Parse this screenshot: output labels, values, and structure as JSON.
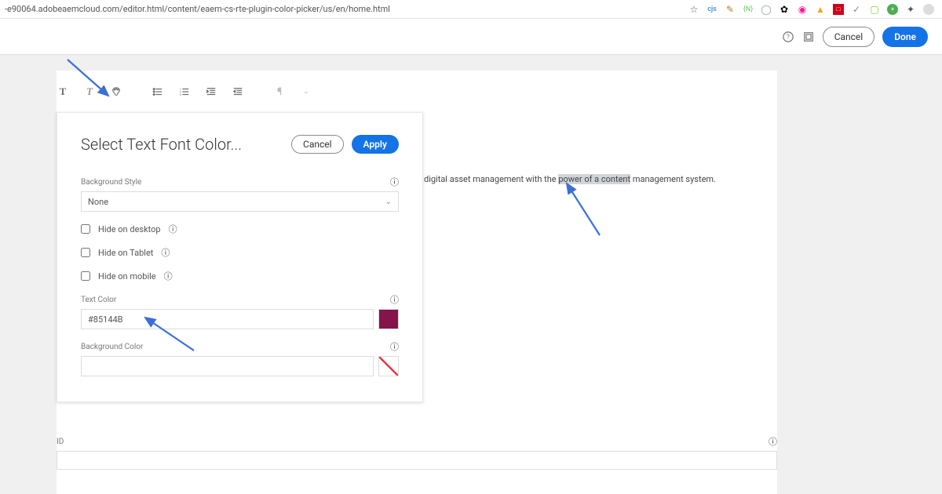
{
  "url": "-e90064.adobeaemcloud.com/editor.html/content/eaem-cs-rte-plugin-color-picker/us/en/home.html",
  "header": {
    "cancel": "Cancel",
    "done": "Done"
  },
  "dialog": {
    "title": "Select Text Font Color...",
    "cancel": "Cancel",
    "apply": "Apply",
    "bg_style_label": "Background Style",
    "bg_style_value": "None",
    "hide_desktop": "Hide on desktop",
    "hide_tablet": "Hide on Tablet",
    "hide_mobile": "Hide on mobile",
    "text_color_label": "Text Color",
    "text_color_value": "#85144B",
    "bg_color_label": "Background Color",
    "bg_color_value": ""
  },
  "content": {
    "prefix": "digital asset management with the ",
    "highlight": "power of a content",
    "suffix": " management system."
  },
  "bottom": {
    "id_label": "ID"
  },
  "colors": {
    "swatch": "#85144B"
  }
}
